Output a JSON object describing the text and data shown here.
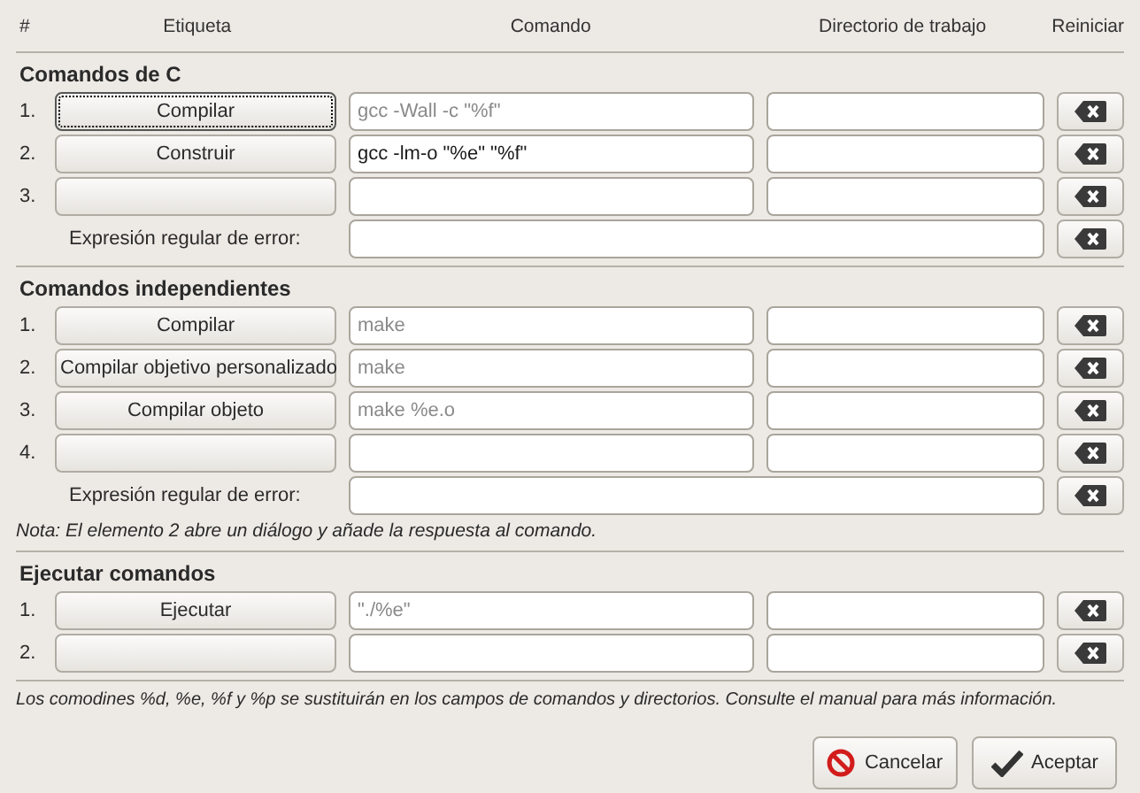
{
  "columns": [
    "#",
    "Etiqueta",
    "Comando",
    "Directorio de trabajo",
    "Reiniciar"
  ],
  "sections": [
    {
      "title": "Comandos de C",
      "rows": [
        {
          "number": "1.",
          "label": "Compilar",
          "focused": true,
          "command": {
            "value": "gcc -Wall -c \"%f\"",
            "inherited": true
          }
        },
        {
          "number": "2.",
          "label": "Construir",
          "focused": false,
          "command": {
            "value": "gcc -lm-o \"%e\" \"%f\"",
            "inherited": false
          }
        },
        {
          "number": "3.",
          "focused": false
        }
      ],
      "error_regex": {
        "label": "Expresión regular de error:"
      }
    },
    {
      "title": "Comandos independientes",
      "rows": [
        {
          "number": "1.",
          "label": "Compilar",
          "focused": false,
          "command": {
            "value": "make",
            "inherited": true
          }
        },
        {
          "number": "2.",
          "label": "Compilar objetivo personalizado",
          "focused": false,
          "command": {
            "value": "make",
            "inherited": true
          }
        },
        {
          "number": "3.",
          "label": "Compilar objeto",
          "focused": false,
          "command": {
            "value": "make %e.o",
            "inherited": true
          }
        },
        {
          "number": "4.",
          "focused": false
        }
      ],
      "error_regex": {
        "label": "Expresión regular de error:"
      },
      "note": "Nota: El elemento 2 abre un diálogo y añade la respuesta al comando."
    },
    {
      "title": "Ejecutar comandos",
      "rows": [
        {
          "number": "1.",
          "label": "Ejecutar",
          "focused": false,
          "command": {
            "value": "\"./%e\"",
            "inherited": true
          }
        },
        {
          "number": "2.",
          "focused": false
        }
      ]
    }
  ],
  "footer_note": "Los comodines %d, %e, %f y %p se sustituirán en los campos de comandos y directorios. Consulte el manual para más información.",
  "buttons": [
    {
      "kind": "cancel",
      "label": "Cancelar"
    },
    {
      "kind": "ok",
      "label": "Aceptar"
    }
  ]
}
